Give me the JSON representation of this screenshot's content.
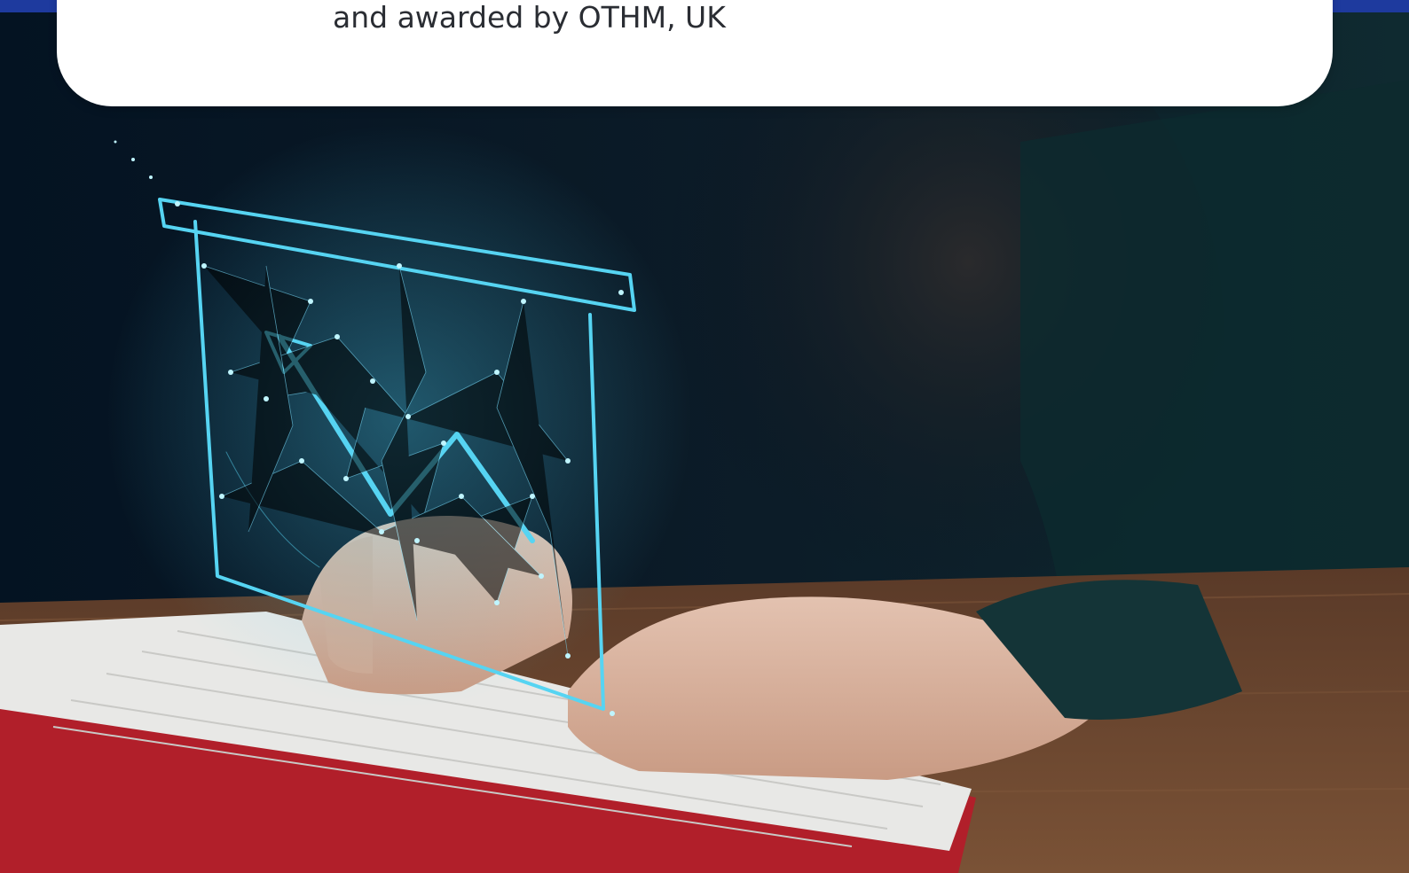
{
  "info_card": {
    "text": "and awarded by OTHM, UK"
  },
  "colors": {
    "brand_blue": "#1e3a9e",
    "card_background": "#ffffff",
    "card_text": "#2a2d33",
    "hologram": "#4fd3f5"
  },
  "hero_image": {
    "icon": "photo-icon"
  }
}
